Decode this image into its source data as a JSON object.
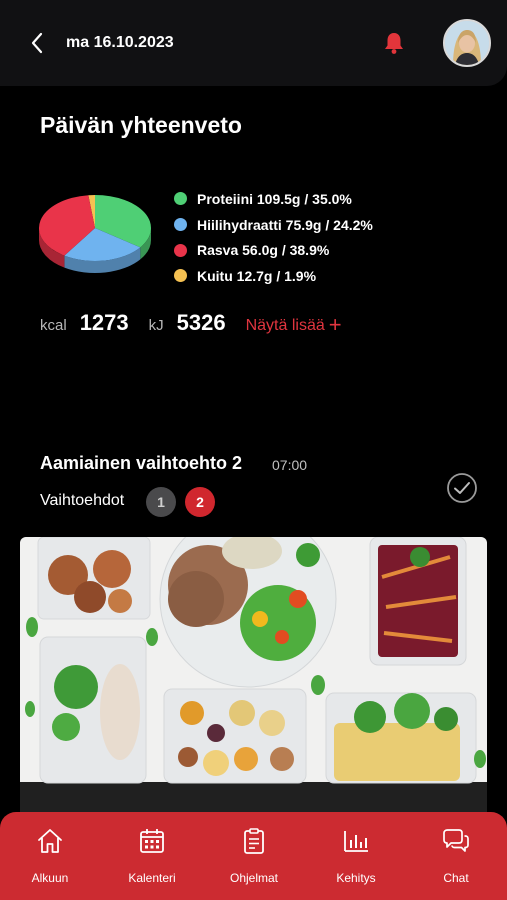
{
  "header": {
    "date": "ma 16.10.2023"
  },
  "summary": {
    "title": "Päivän yhteenveto",
    "legend": [
      {
        "label": "Proteiini 109.5g / 35.0%",
        "color": "#4fcf75"
      },
      {
        "label": "Hiilihydraatti 75.9g / 24.2%",
        "color": "#6fb3ef"
      },
      {
        "label": "Rasva 56.0g / 38.9%",
        "color": "#e9344a"
      },
      {
        "label": "Kuitu 12.7g / 1.9%",
        "color": "#f5c152"
      }
    ],
    "kcal_unit": "kcal",
    "kcal_value": "1273",
    "kj_unit": "kJ",
    "kj_value": "5326",
    "more_label": "Näytä lisää"
  },
  "chart_data": {
    "type": "pie",
    "categories": [
      "Proteiini",
      "Hiilihydraatti",
      "Rasva",
      "Kuitu"
    ],
    "values": [
      35.0,
      24.2,
      38.9,
      1.9
    ],
    "colors": [
      "#4fcf75",
      "#6fb3ef",
      "#e9344a",
      "#f5c152"
    ]
  },
  "meal": {
    "title": "Aamiainen vaihtoehto 2",
    "time": "07:00",
    "options_label": "Vaihtoehdot",
    "options": [
      "1",
      "2"
    ],
    "selected_option": "2"
  },
  "nav": {
    "items": [
      {
        "label": "Alkuun",
        "icon": "home-icon"
      },
      {
        "label": "Kalenteri",
        "icon": "calendar-icon"
      },
      {
        "label": "Ohjelmat",
        "icon": "clipboard-icon"
      },
      {
        "label": "Kehitys",
        "icon": "bar-chart-icon"
      },
      {
        "label": "Chat",
        "icon": "chat-icon"
      }
    ]
  }
}
